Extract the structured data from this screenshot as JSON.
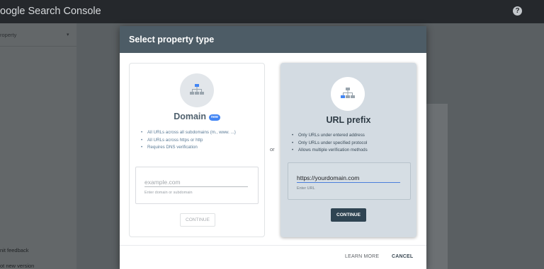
{
  "app": {
    "title": "oogle Search Console",
    "help_glyph": "?",
    "property_label": "roperty",
    "caret_glyph": "▾",
    "sidebar_links": [
      "nit feedback",
      "ot new version"
    ]
  },
  "dialog": {
    "title": "Select property type",
    "or_label": "or",
    "domain": {
      "icon": "sitemap-icon",
      "title": "Domain",
      "badge": "new",
      "bullets": [
        "All URLs across all subdomains (m., www. ...)",
        "All URLs across https or http",
        "Requires DNS verification"
      ],
      "input_value": "",
      "input_placeholder": "example.com",
      "input_helper": "Enter domain or subdomain",
      "continue_label": "CONTINUE"
    },
    "url_prefix": {
      "icon": "sitemap-icon",
      "title": "URL prefix",
      "bullets": [
        "Only URLs under entered address",
        "Only URLs under specified protocol",
        "Allows multiple verification methods"
      ],
      "input_value": "https://yourdomain.com",
      "input_helper": "Enter URL",
      "continue_label": "CONTINUE"
    },
    "footer": {
      "learn_more_label": "LEARN MORE",
      "cancel_label": "CANCEL"
    }
  },
  "colors": {
    "header_bg": "#4d5c66",
    "selected_card_bg": "#d3dbe2",
    "continue_bg": "#2f4452",
    "accent_blue": "#4285f4"
  }
}
